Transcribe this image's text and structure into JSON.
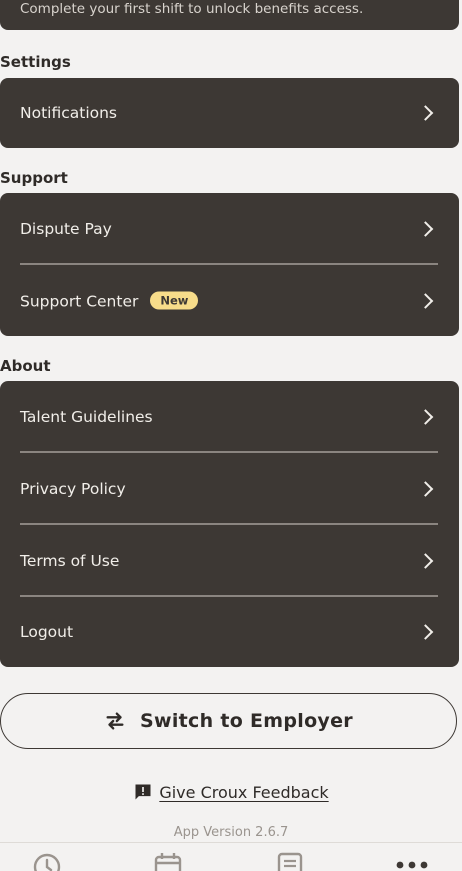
{
  "benefits": {
    "message": "Complete your first shift to unlock benefits access."
  },
  "settings": {
    "title": "Settings",
    "items": [
      {
        "label": "Notifications"
      }
    ]
  },
  "support": {
    "title": "Support",
    "items": [
      {
        "label": "Dispute Pay"
      },
      {
        "label": "Support Center",
        "badge": "New"
      }
    ]
  },
  "about": {
    "title": "About",
    "items": [
      {
        "label": "Talent Guidelines"
      },
      {
        "label": "Privacy Policy"
      },
      {
        "label": "Terms of Use"
      },
      {
        "label": "Logout"
      }
    ]
  },
  "switch_button": {
    "label": "Switch to Employer",
    "icon": "swap-arrows-icon"
  },
  "feedback": {
    "label": "Give Croux Feedback",
    "icon": "feedback-icon"
  },
  "app_version": "App Version 2.6.7",
  "tabbar": {
    "tabs": [
      {
        "icon": "clock-icon"
      },
      {
        "icon": "calendar-icon"
      },
      {
        "icon": "document-icon"
      },
      {
        "icon": "more-icon",
        "active": true
      }
    ]
  },
  "colors": {
    "card": "#3d3834",
    "background": "#f3f2f1",
    "badge": "#f7dc8a",
    "text_dark": "#2f2b28"
  }
}
